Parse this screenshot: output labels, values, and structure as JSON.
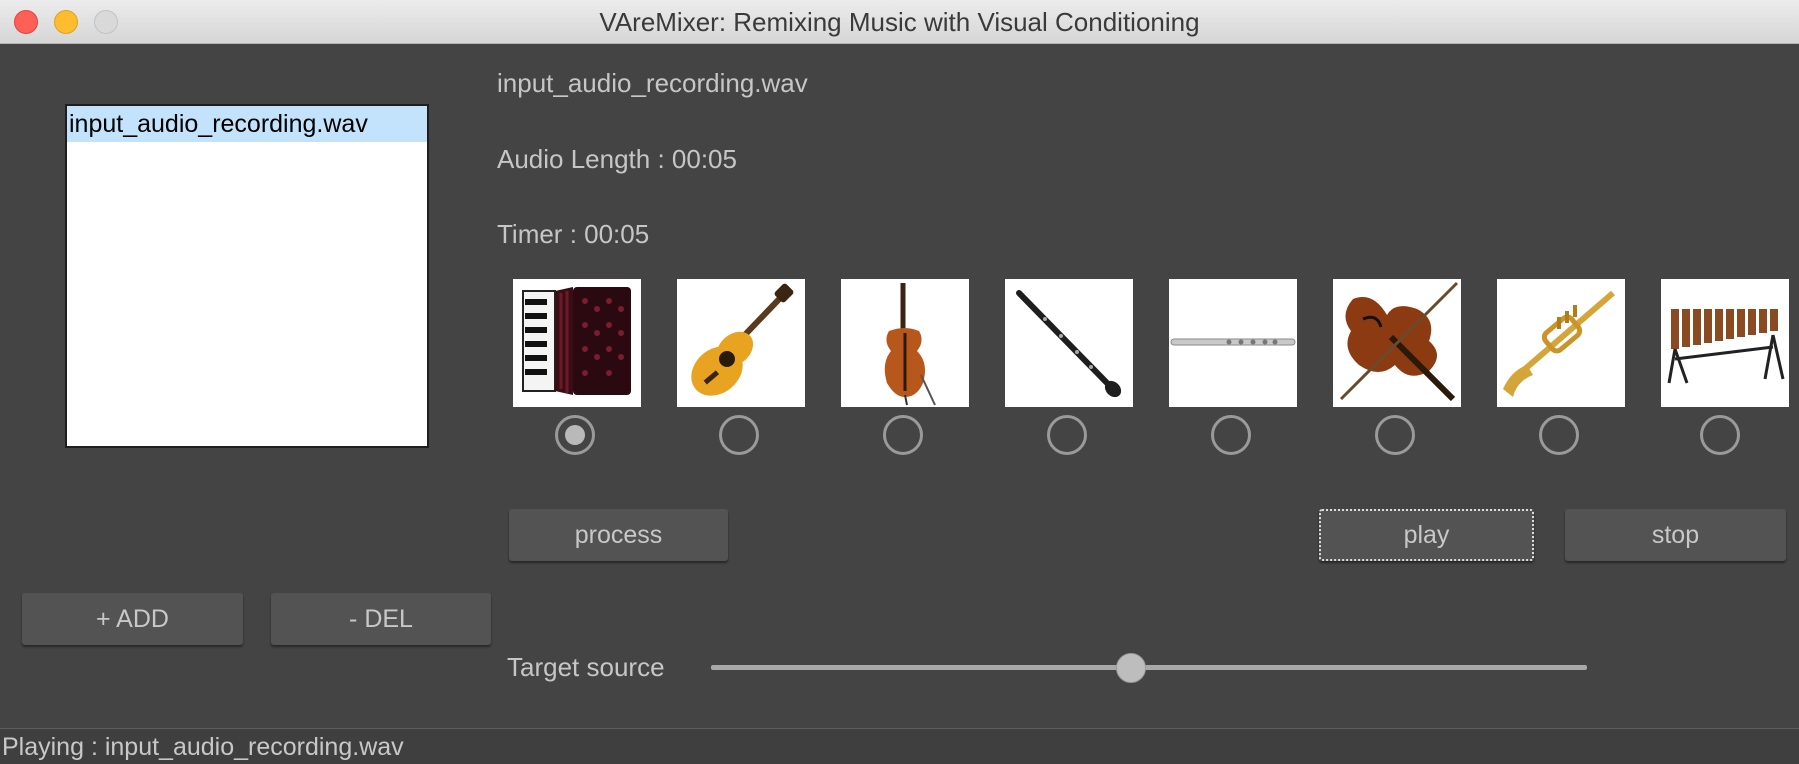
{
  "window": {
    "title": "VAreMixer: Remixing Music with Visual Conditioning"
  },
  "file_list": {
    "items": [
      "input_audio_recording.wav"
    ]
  },
  "info": {
    "filename": "input_audio_recording.wav",
    "audio_length": "Audio Length : 00:05",
    "timer": "Timer : 00:05"
  },
  "instruments": [
    {
      "name": "accordion-icon",
      "selected": true
    },
    {
      "name": "acoustic-guitar-icon",
      "selected": false
    },
    {
      "name": "cello-icon",
      "selected": false
    },
    {
      "name": "clarinet-icon",
      "selected": false
    },
    {
      "name": "flute-icon",
      "selected": false
    },
    {
      "name": "violin-icon",
      "selected": false
    },
    {
      "name": "trumpet-icon",
      "selected": false
    },
    {
      "name": "xylophone-icon",
      "selected": false
    }
  ],
  "buttons": {
    "process": "process",
    "play": "play",
    "stop": "stop",
    "add": "+ ADD",
    "del": "- DEL"
  },
  "slider": {
    "label": "Target source",
    "value": 0.48
  },
  "status": {
    "text": "Playing : input_audio_recording.wav"
  }
}
